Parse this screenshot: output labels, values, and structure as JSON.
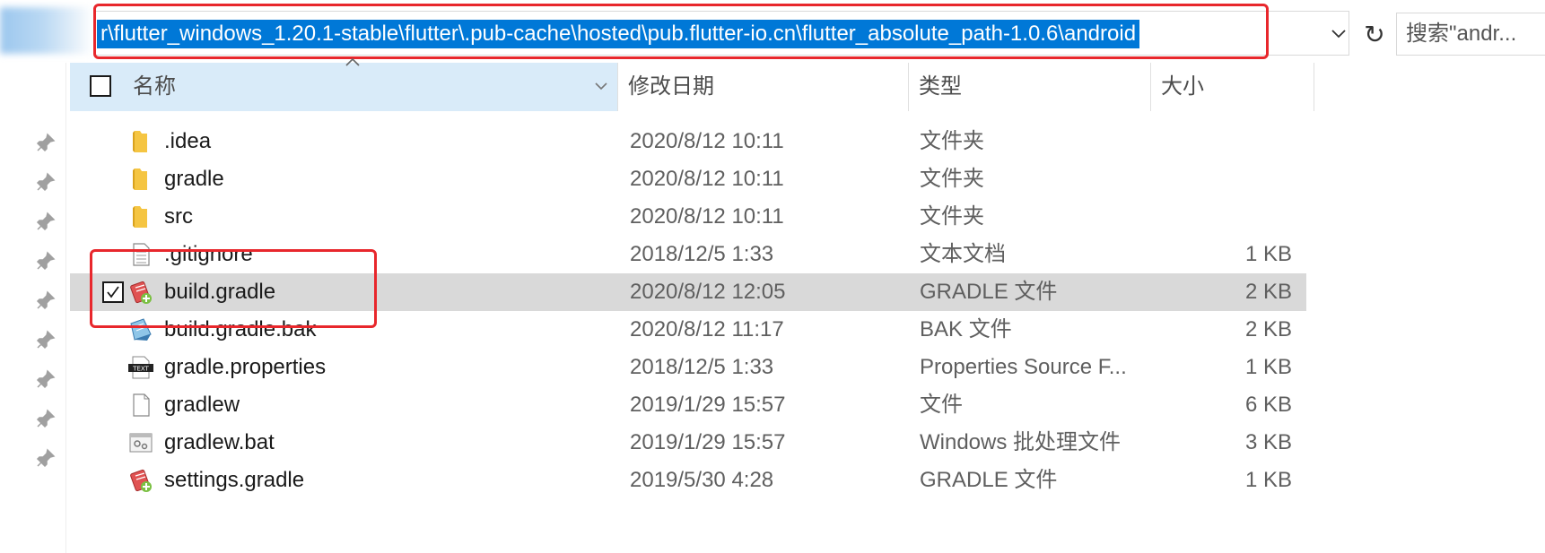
{
  "address_bar": {
    "path": "r\\flutter_windows_1.20.1-stable\\flutter\\.pub-cache\\hosted\\pub.flutter-io.cn\\flutter_absolute_path-1.0.6\\android",
    "refresh_glyph": "↻",
    "search_placeholder": "搜索\"andr..."
  },
  "columns": {
    "name": "名称",
    "date": "修改日期",
    "type": "类型",
    "size": "大小"
  },
  "files": [
    {
      "name": ".idea",
      "date": "2020/8/12 10:11",
      "type": "文件夹",
      "size": "",
      "icon": "folder-icon"
    },
    {
      "name": "gradle",
      "date": "2020/8/12 10:11",
      "type": "文件夹",
      "size": "",
      "icon": "folder-icon"
    },
    {
      "name": "src",
      "date": "2020/8/12 10:11",
      "type": "文件夹",
      "size": "",
      "icon": "folder-icon"
    },
    {
      "name": ".gitignore",
      "date": "2018/12/5 1:33",
      "type": "文本文档",
      "size": "1 KB",
      "icon": "text-file-icon"
    },
    {
      "name": "build.gradle",
      "date": "2020/8/12 12:05",
      "type": "GRADLE 文件",
      "size": "2 KB",
      "icon": "gradle-file-icon",
      "selected": true
    },
    {
      "name": "build.gradle.bak",
      "date": "2020/8/12 11:17",
      "type": "BAK 文件",
      "size": "2 KB",
      "icon": "bak-file-icon"
    },
    {
      "name": "gradle.properties",
      "date": "2018/12/5 1:33",
      "type": "Properties Source F...",
      "size": "1 KB",
      "icon": "properties-file-icon"
    },
    {
      "name": "gradlew",
      "date": "2019/1/29 15:57",
      "type": "文件",
      "size": "6 KB",
      "icon": "blank-file-icon"
    },
    {
      "name": "gradlew.bat",
      "date": "2019/1/29 15:57",
      "type": "Windows 批处理文件",
      "size": "3 KB",
      "icon": "batch-file-icon"
    },
    {
      "name": "settings.gradle",
      "date": "2019/5/30 4:28",
      "type": "GRADLE 文件",
      "size": "1 KB",
      "icon": "gradle-file-icon"
    }
  ],
  "colors": {
    "selection_blue": "#0078d7",
    "annotation_red": "#e8272c",
    "header_bg": "#d9ebf9",
    "selected_row_bg": "#d9d9d9"
  }
}
